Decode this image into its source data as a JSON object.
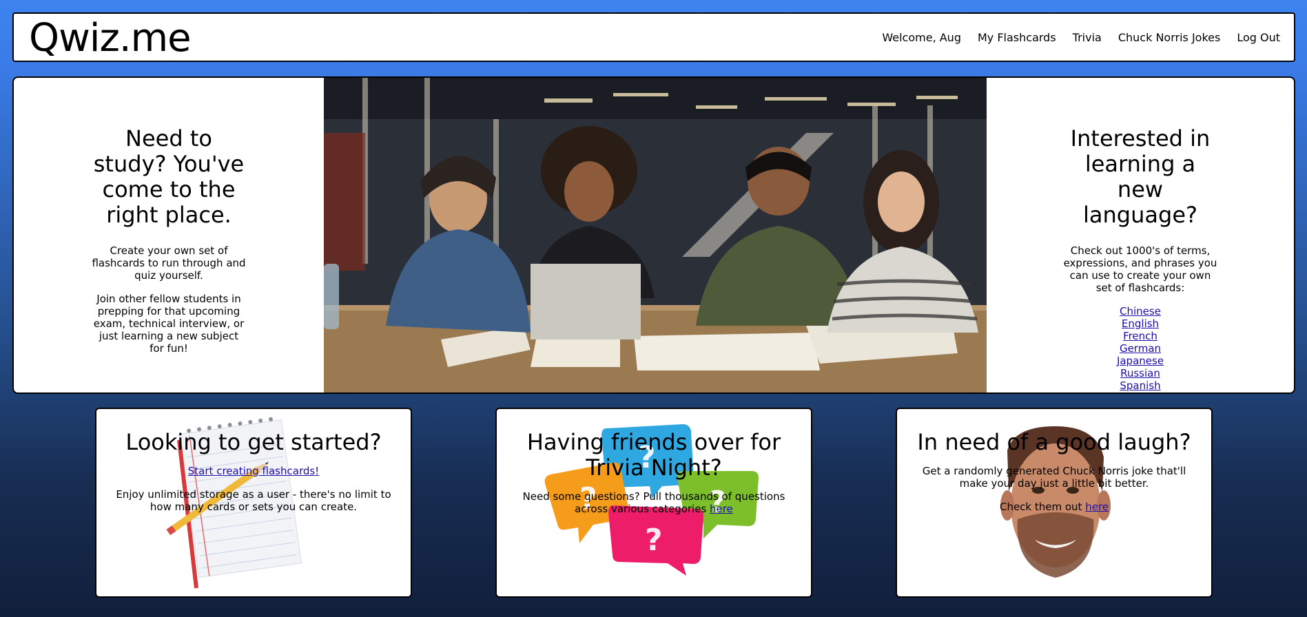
{
  "header": {
    "logo": "Qwiz.me",
    "nav": [
      "Welcome, Aug",
      "My Flashcards",
      "Trivia",
      "Chuck Norris Jokes",
      "Log Out"
    ]
  },
  "hero": {
    "left": {
      "title": "Need to study? You've come to the right place.",
      "p1": "Create your own set of flashcards to run through and quiz yourself.",
      "p2": "Join other fellow students in prepping for that upcoming exam, technical interview, or just learning a new subject for fun!"
    },
    "right": {
      "title": "Interested in learning a new language?",
      "p1": "Check out 1000's of terms, expressions, and phrases you can use to create your own set of flashcards:",
      "languages": [
        "Chinese",
        "English",
        "French",
        "German",
        "Japanese",
        "Russian",
        "Spanish"
      ]
    }
  },
  "cards": {
    "started": {
      "title": "Looking to get started?",
      "link": "Start creating flashcards!",
      "text": "Enjoy unlimited storage as a user - there's no limit to how many cards or sets you can create."
    },
    "trivia": {
      "title": "Having friends over for Trivia Night?",
      "text": "Need some questions? Pull thousands of questions across various categories ",
      "link": "here"
    },
    "laugh": {
      "title": "In need of a good laugh?",
      "text": "Get a randomly generated Chuck Norris joke that'll make your day just a little bit better.",
      "text2": "Check them out ",
      "link": "here"
    }
  },
  "colors": {
    "page_top": "#3d84ef",
    "page_bottom": "#111f3c",
    "link": "#1a0dab"
  }
}
